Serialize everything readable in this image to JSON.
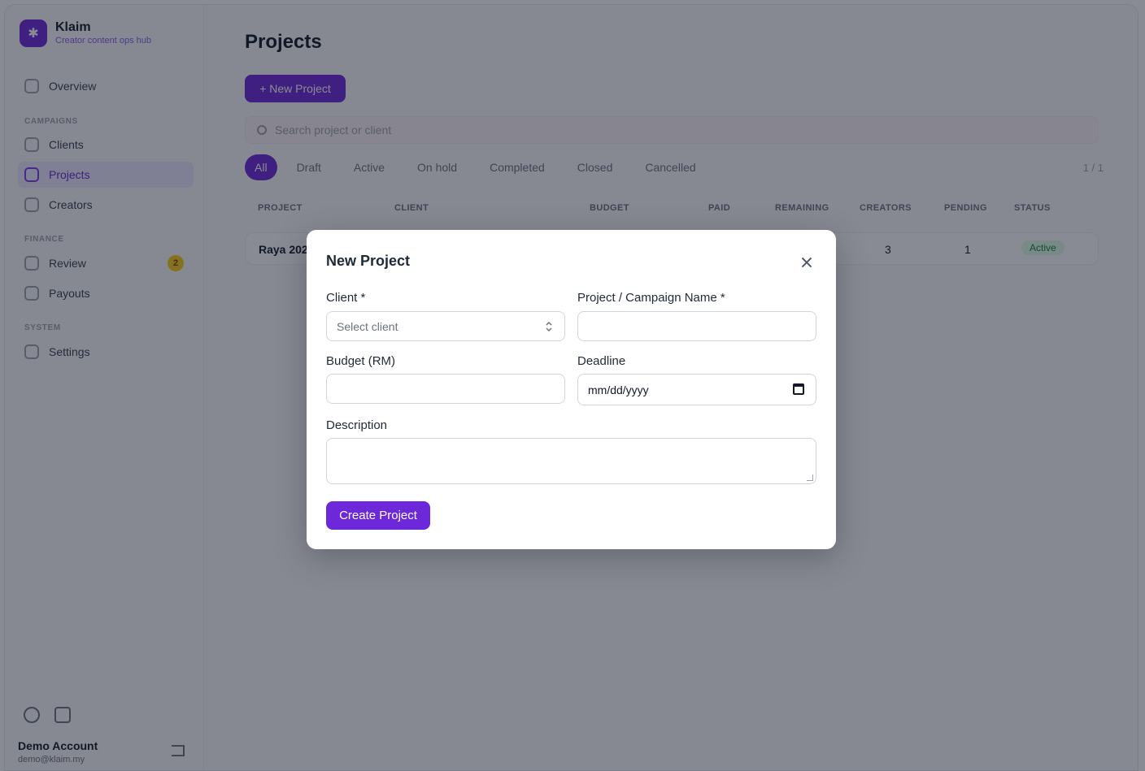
{
  "app": {
    "brand_name": "Klaim",
    "brand_sub": "Creator content ops hub"
  },
  "sidebar": {
    "items": [
      {
        "label": "Overview"
      },
      {
        "label": "Clients"
      },
      {
        "label": "Projects"
      },
      {
        "label": "Creators"
      },
      {
        "label": "Review",
        "badge": "2"
      },
      {
        "label": "Payouts"
      },
      {
        "label": "Settings"
      }
    ],
    "sections": [
      "CAMPAIGNS",
      "FINANCE",
      "SYSTEM"
    ],
    "account_name": "Demo Account",
    "account_email": "demo@klaim.my"
  },
  "main": {
    "title": "Projects",
    "new_button": "+ New Project",
    "search_placeholder": "Search project or client",
    "tabs": [
      "All",
      "Draft",
      "Active",
      "On hold",
      "Completed",
      "Closed",
      "Cancelled"
    ],
    "tab_count": "1 / 1",
    "columns": [
      "PROJECT",
      "CLIENT",
      "BUDGET",
      "PAID",
      "REMAINING",
      "CREATORS",
      "PENDING",
      "STATUS"
    ],
    "rows": [
      {
        "project": "Raya 2025",
        "creators": "3",
        "pending": "1",
        "status": "Active"
      }
    ]
  },
  "modal": {
    "title": "New Project",
    "client_label": "Client *",
    "client_placeholder": "Select client",
    "name_label": "Project / Campaign Name *",
    "name_value": "",
    "budget_label": "Budget (RM)",
    "budget_value": "",
    "deadline_label": "Deadline",
    "deadline_placeholder": "mm/dd/yyyy",
    "description_label": "Description",
    "description_value": "",
    "submit_label": "Create Project"
  },
  "colors": {
    "accent": "#6d28d9",
    "overlay": "rgba(17,24,39,0.5)"
  }
}
